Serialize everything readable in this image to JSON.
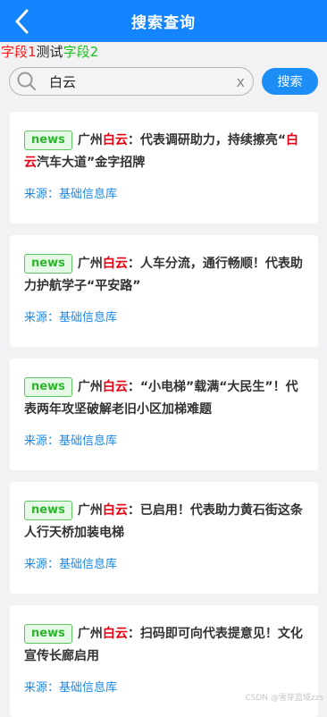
{
  "header": {
    "title": "搜索查询",
    "back_icon": "chevron-left-icon"
  },
  "legend": {
    "field1": "字段1",
    "middle": "测试",
    "field2": "字段2"
  },
  "search": {
    "value": "白云",
    "clear_label": "x",
    "button_label": "搜索",
    "icon": "search-icon"
  },
  "results": [
    {
      "tag": "news",
      "prefix": "广州",
      "keyword": "白云",
      "rest": "：代表调研助力，持续擦亮",
      "keyword2": "白云",
      "line2_prefix": "“",
      "line2_rest": "汽车大道”金字招牌",
      "source_label": "来源：",
      "source": "基础信息库"
    },
    {
      "tag": "news",
      "prefix": "广州",
      "keyword": "白云",
      "rest": "：人车分流，通行畅顺！代表助力护航学子“平安路”",
      "source_label": "来源：",
      "source": "基础信息库"
    },
    {
      "tag": "news",
      "prefix": "广州",
      "keyword": "白云",
      "rest": "：“小电梯”载满“大民生”！代表两年攻坚破解老旧小区加梯难题",
      "source_label": "来源：",
      "source": "基础信息库"
    },
    {
      "tag": "news",
      "prefix": "广州",
      "keyword": "白云",
      "rest": "：已启用！代表助力黄石街这条人行天桥加装电梯",
      "source_label": "来源：",
      "source": "基础信息库"
    },
    {
      "tag": "news",
      "prefix": "广州",
      "keyword": "白云",
      "rest": "：扫码即可向代表提意见！文化宣传长廊启用",
      "source_label": "来源：",
      "source": "基础信息库"
    }
  ],
  "watermark": "CSDN @雪芽蓝域zzs",
  "colors": {
    "header": "#1585ff",
    "button": "#1c8ef5",
    "highlight": "#e60012",
    "tag_green": "#2db52d",
    "source_blue": "#1e88e5"
  }
}
